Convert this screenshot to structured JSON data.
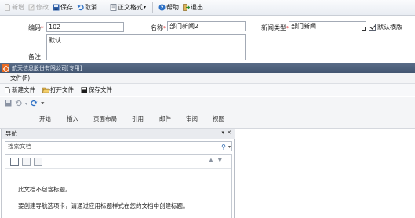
{
  "toolbar": {
    "new": "新增",
    "edit": "修改",
    "save": "保存",
    "cancel": "取消",
    "body_format": "正文格式",
    "help": "帮助",
    "exit": "退出"
  },
  "form": {
    "code_label": "编码",
    "code_value": "102",
    "name_label": "名称",
    "name_value": "部门新闻2",
    "required_mark": "*",
    "type_label": "新闻类型",
    "type_value": "部门新闻",
    "default_checkbox_label": "默认横版",
    "default_checked": true,
    "note_label": "备注",
    "note_value": "默认"
  },
  "office": {
    "title": "航天信息股份有限公司[专用]",
    "menu_file": "文件(F)",
    "new_file": "新建文件",
    "open_file": "打开文件",
    "save_file": "保存文件"
  },
  "ribbon": {
    "tabs": [
      "开始",
      "插入",
      "页面布局",
      "引用",
      "邮件",
      "审阅",
      "视图"
    ]
  },
  "nav_pane": {
    "title": "导航",
    "search_placeholder": "搜索文档",
    "message1": "此文档不包含标题。",
    "message2": "要创建导航选项卡，请通过应用标题样式在您的文档中创建标题。"
  }
}
